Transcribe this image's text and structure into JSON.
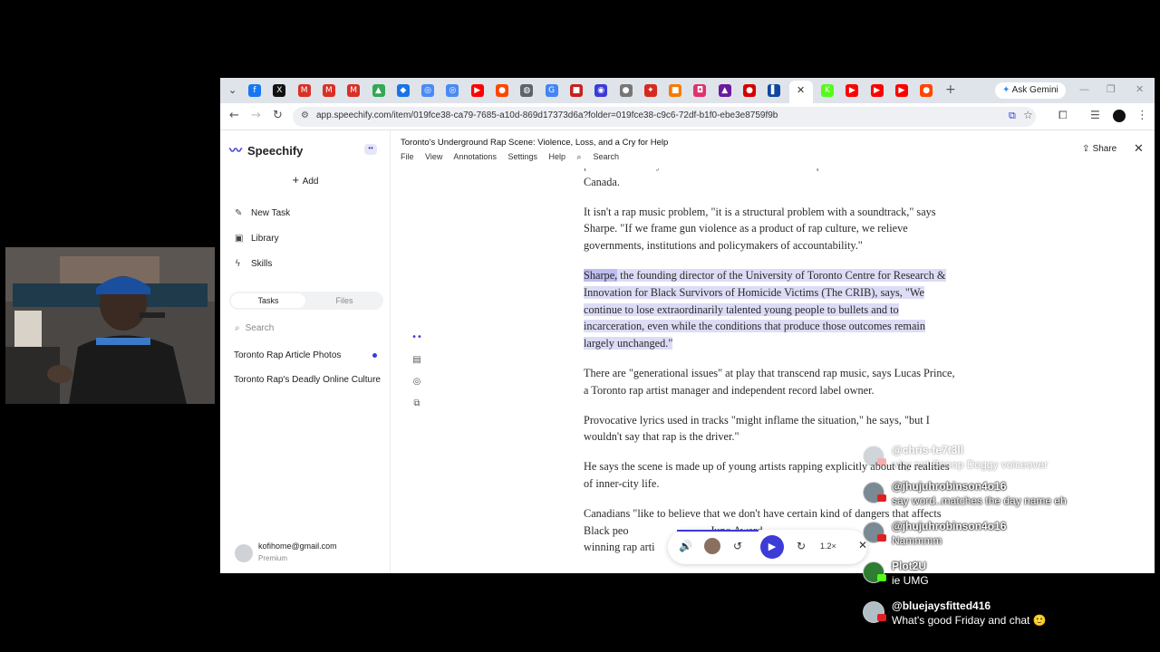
{
  "browser": {
    "ask_gemini": "Ask Gemini",
    "url": "app.speechify.com/item/019fce38-ca79-7685-a10d-869d17373d6a?folder=019fce38-c9c6-72df-b1f0-ebe3e8759f9b",
    "tab_icons": [
      {
        "name": "facebook-tab-icon",
        "color": "#1877f2",
        "glyph": "f"
      },
      {
        "name": "x-tab-icon",
        "color": "#111111",
        "glyph": "X"
      },
      {
        "name": "gmail-tab-icon",
        "color": "#d93025",
        "glyph": "M"
      },
      {
        "name": "gmail-tab-icon-2",
        "color": "#d93025",
        "glyph": "M"
      },
      {
        "name": "gmail-tab-icon-3",
        "color": "#d93025",
        "glyph": "M"
      },
      {
        "name": "drive-tab-icon",
        "color": "#34a853",
        "glyph": "▲"
      },
      {
        "name": "blue-app-tab-icon",
        "color": "#1a73e8",
        "glyph": "◆"
      },
      {
        "name": "circle-app-tab-icon",
        "color": "#4a8af4",
        "glyph": "◎"
      },
      {
        "name": "circle-app-tab-icon-2",
        "color": "#4a8af4",
        "glyph": "◎"
      },
      {
        "name": "youtube-tab-icon",
        "color": "#ff0000",
        "glyph": "▶"
      },
      {
        "name": "reddit-tab-icon",
        "color": "#ff4500",
        "glyph": "●"
      },
      {
        "name": "globe-tab-icon",
        "color": "#5f6368",
        "glyph": "◍"
      },
      {
        "name": "google-tab-icon",
        "color": "#4285f4",
        "glyph": "G"
      },
      {
        "name": "red-app-tab-icon",
        "color": "#c5221f",
        "glyph": "■"
      },
      {
        "name": "speechify-tab-icon",
        "color": "#3b3bd8",
        "glyph": "◉"
      },
      {
        "name": "grey-app-tab-icon",
        "color": "#777777",
        "glyph": "●"
      },
      {
        "name": "canada-tab-icon",
        "color": "#d52b1e",
        "glyph": "✦"
      },
      {
        "name": "orange-app-tab-icon",
        "color": "#f57c00",
        "glyph": "■"
      },
      {
        "name": "instagram-tab-icon",
        "color": "#e1306c",
        "glyph": "◘"
      },
      {
        "name": "purple-app-tab-icon",
        "color": "#6a1b9a",
        "glyph": "▲"
      },
      {
        "name": "red-badge-tab-icon",
        "color": "#d50000",
        "glyph": "●"
      },
      {
        "name": "blue-square-tab-icon",
        "color": "#0d47a1",
        "glyph": "▌"
      }
    ],
    "tab_icons_after": [
      {
        "name": "kick-tab-icon",
        "color": "#53fc18",
        "glyph": "K"
      },
      {
        "name": "youtube-tab-icon-2",
        "color": "#ff0000",
        "glyph": "▶"
      },
      {
        "name": "youtube-tab-icon-3",
        "color": "#ff0000",
        "glyph": "▶"
      },
      {
        "name": "youtube-tab-icon-4",
        "color": "#ff0000",
        "glyph": "▶"
      },
      {
        "name": "reddit-tab-icon-2",
        "color": "#ff4500",
        "glyph": "●"
      }
    ]
  },
  "sidebar": {
    "brand": "Speechify",
    "add": "Add",
    "nav": [
      {
        "label": "New Task",
        "icon": "edit-icon"
      },
      {
        "label": "Library",
        "icon": "library-icon"
      },
      {
        "label": "Skills",
        "icon": "bolt-icon"
      }
    ],
    "tabs": {
      "tasks": "Tasks",
      "files": "Files"
    },
    "search_placeholder": "Search",
    "tasks": [
      "Toronto Rap Article Photos",
      "Toronto Rap's Deadly Online Culture"
    ],
    "user": {
      "email": "kofihome@gmail.com",
      "plan": "Premium"
    }
  },
  "main": {
    "title": "Toronto's Underground Rap Scene: Violence, Loss, and a Cry for Help",
    "menu": [
      "File",
      "View",
      "Annotations",
      "Settings",
      "Help"
    ],
    "search_label": "Search",
    "share": "Share",
    "article": {
      "fragment_top": "published a study on firearm-related homicides as a public health concern in",
      "p0_end": "Canada.",
      "p1": "It isn't a rap music problem, \"it is a structural problem with a soundtrack,\" says Sharpe. \"If we frame gun violence as a product of rap culture, we relieve governments, institutions and policymakers of accountability.\"",
      "p2_first": "Sharpe,",
      "p2_rest": " the founding director of the University of Toronto Centre for Research & Innovation for Black Survivors of Homicide Victims (The CRIB), says, \"We continue to lose extraordinarily talented young people to bullets and to incarceration, even while the conditions that produce those outcomes remain largely unchanged.\"",
      "p3": "There are \"generational issues\" at play that transcend rap music, says Lucas Prince, a Toronto rap artist manager and independent record label owner.",
      "p4": "Provocative lyrics used in tracks \"might inflame the situation,\" he says, \"but I wouldn't say that rap is the driver.\"",
      "p5": "He says the scene is made up of young artists rapping explicitly about the realities of inner-city life.",
      "p6": "Canadians \"like to believe that we don't have certain kind of dangers that affects Black peo",
      "p6_tail_a": "Juno Award-",
      "p6_line3": "winning rap arti"
    },
    "player": {
      "speed": "1.2×"
    }
  },
  "chat": [
    {
      "user": "@chris-fe7t3ll",
      "text": "why not Snoop Doggy voiceover",
      "faded": true
    },
    {
      "user": "@jhujuhrobinson4o16",
      "text": "say word..matches the day name eh",
      "faded": false
    },
    {
      "user": "@jhujuhrobinson4o16",
      "text": "Nammmm",
      "faded": false
    },
    {
      "user": "Plot2U",
      "text": "ie UMG",
      "faded": false
    },
    {
      "user": "@bluejaysfitted416",
      "text": "What's good Friday and chat 🙂",
      "faded": false
    }
  ]
}
